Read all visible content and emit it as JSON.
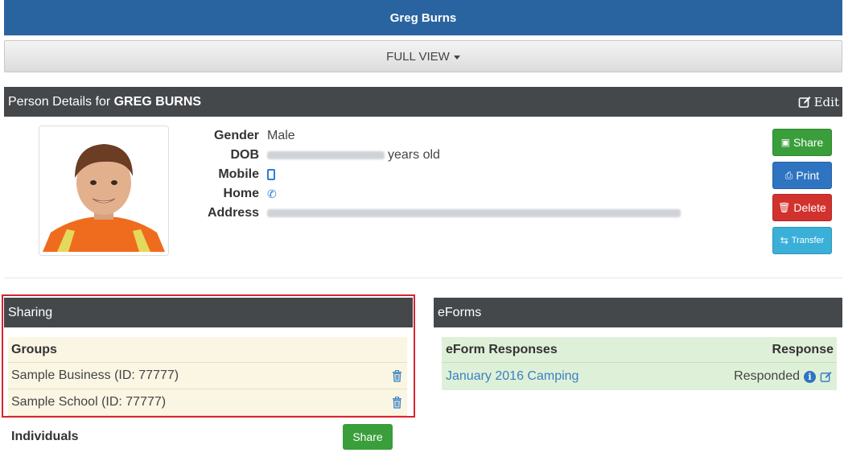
{
  "header": {
    "title": "Greg Burns"
  },
  "view_bar": {
    "label": "FULL VIEW"
  },
  "details": {
    "header_prefix": "Person Details for ",
    "header_name": "GREG BURNS",
    "edit_label": "Edit",
    "fields": {
      "gender_label": "Gender",
      "gender_value": "Male",
      "dob_label": "DOB",
      "dob_suffix": "years old",
      "mobile_label": "Mobile",
      "home_label": "Home",
      "address_label": "Address"
    },
    "actions": {
      "share": "Share",
      "print": "Print",
      "delete": "Delete",
      "transfer": "Transfer"
    }
  },
  "sharing": {
    "title": "Sharing",
    "groups_header": "Groups",
    "groups": [
      {
        "name": "Sample Business (ID: 77777)"
      },
      {
        "name": "Sample School (ID: 77777)"
      }
    ],
    "individuals_label": "Individuals",
    "share_button": "Share"
  },
  "eforms": {
    "title": "eForms",
    "col_responses": "eForm Responses",
    "col_response": "Response",
    "rows": [
      {
        "name": "January 2016 Camping",
        "status": "Responded"
      }
    ]
  },
  "colors": {
    "topbar": "#2a64a0",
    "panel_header": "#45484b",
    "highlight": "#d9232e",
    "share_green": "#3a9e3a",
    "print_blue": "#2f74c0",
    "delete_red": "#d2322d",
    "transfer_cyan": "#3ab0d8"
  }
}
